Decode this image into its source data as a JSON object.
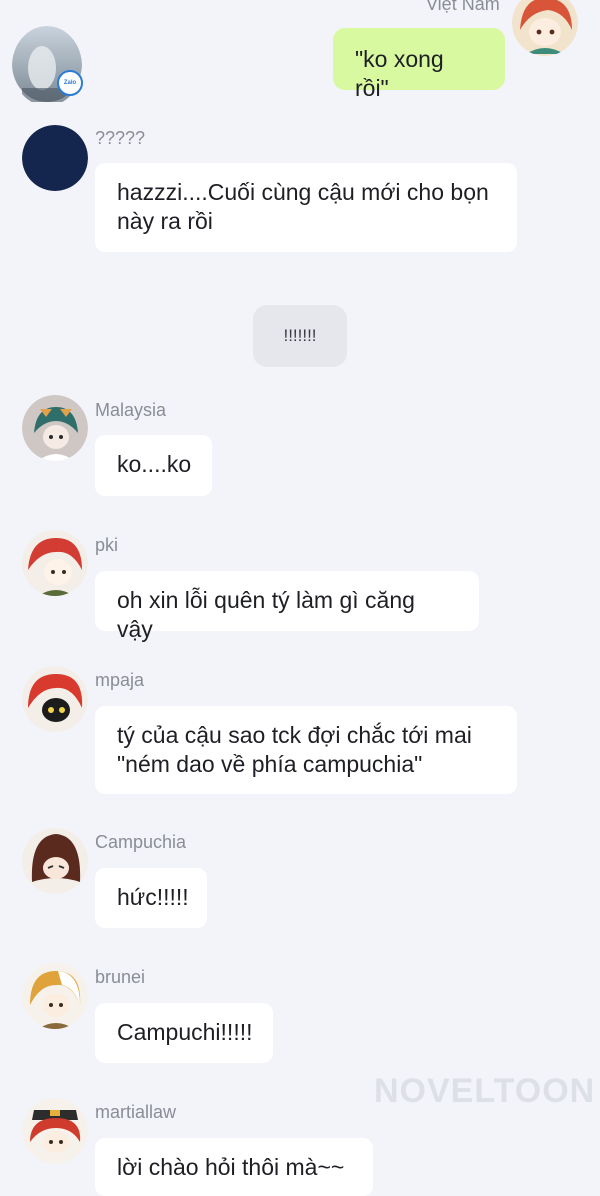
{
  "colors": {
    "background": "#f3f4f9",
    "bubble_incoming": "#ffffff",
    "bubble_outgoing": "#d8f9a0",
    "sender_name": "#8a8d96",
    "system_pill": "#e6e7ec"
  },
  "top_message": {
    "sender": "Việt Nam",
    "text": "\"ko xong rồi\"",
    "avatar_icon": "anime-avatar-icon"
  },
  "zalo_avatar": {
    "icon": "zalo-avatar-icon",
    "badge_label": "Zalo"
  },
  "messages": [
    {
      "sender": "?????",
      "text": "hazzzi....Cuối cùng cậu mới cho bọn này ra rồi",
      "avatar_icon": "navy-avatar-icon"
    },
    {
      "sender": "Malaysia",
      "text": "ko....ko",
      "avatar_icon": "anime-avatar-icon"
    },
    {
      "sender": "pki",
      "text": "oh xin lỗi quên tý làm gì căng vậy",
      "avatar_icon": "anime-avatar-icon"
    },
    {
      "sender": "mpaja",
      "text": "tý của cậu sao tck đợi chắc tới mai \"ném dao về phía campuchia\"",
      "avatar_icon": "anime-avatar-icon"
    },
    {
      "sender": "Campuchia",
      "text": "hức!!!!!",
      "avatar_icon": "anime-avatar-icon"
    },
    {
      "sender": "brunei",
      "text": "Campuchi!!!!!",
      "avatar_icon": "anime-avatar-icon"
    },
    {
      "sender": "martiallaw",
      "text": "lời chào hỏi thôi mà~~",
      "avatar_icon": "anime-avatar-icon"
    }
  ],
  "system_message": "!!!!!!!",
  "watermark": "NOVELTOON"
}
